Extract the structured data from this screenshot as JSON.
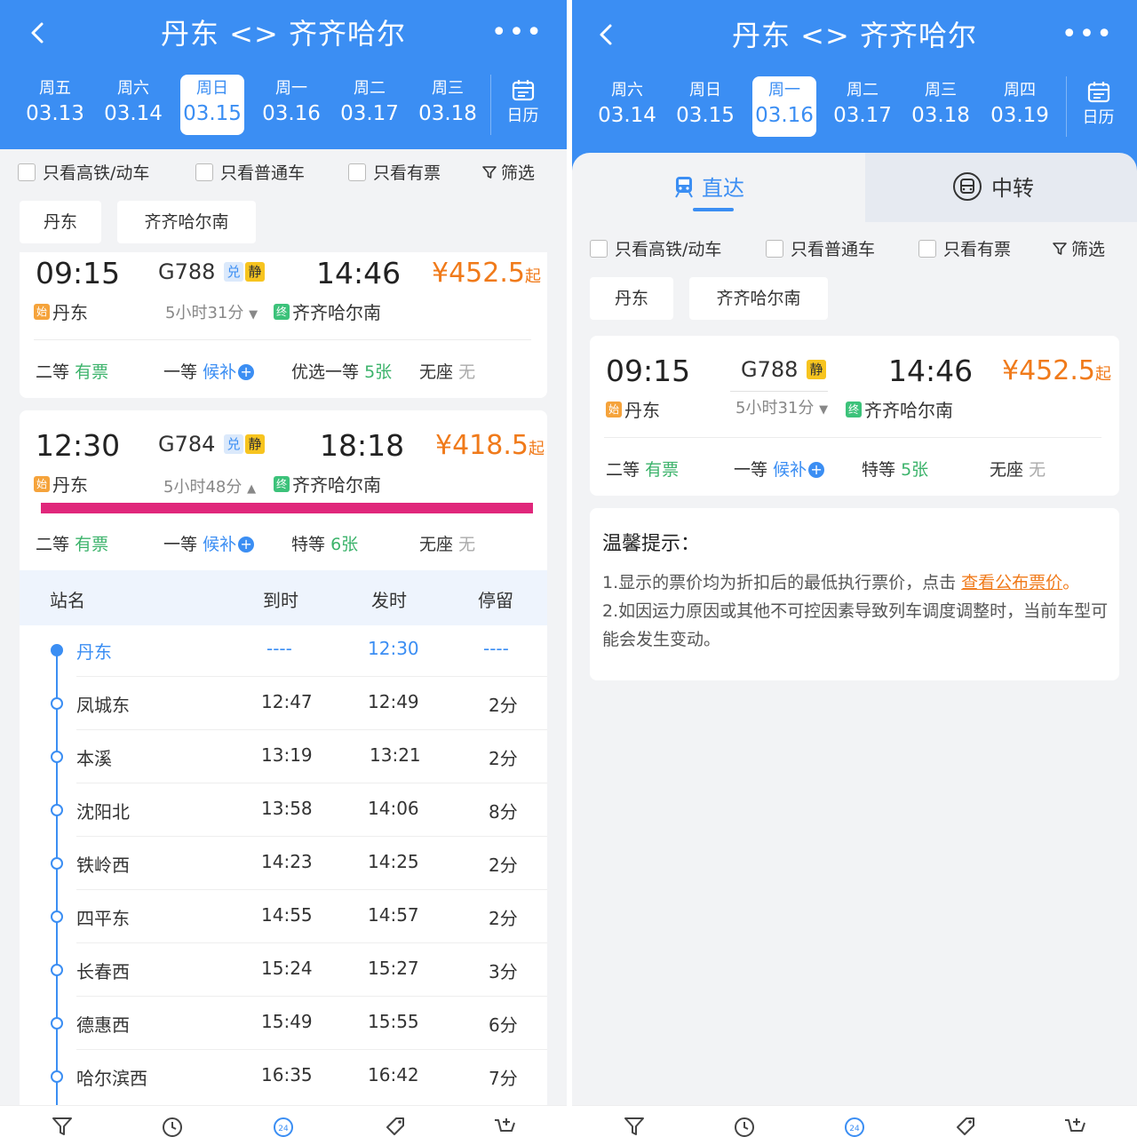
{
  "left": {
    "header": {
      "title": "丹东 <> 齐齐哈尔",
      "more": "•••"
    },
    "dates": [
      {
        "week": "周五",
        "date": "03.13"
      },
      {
        "week": "周六",
        "date": "03.14"
      },
      {
        "week": "周日",
        "date": "03.15",
        "selected": true
      },
      {
        "week": "周一",
        "date": "03.16"
      },
      {
        "week": "周二",
        "date": "03.17"
      },
      {
        "week": "周三",
        "date": "03.18"
      }
    ],
    "calendar_label": "日历",
    "filters": [
      "只看高铁/动车",
      "只看普通车",
      "只看有票"
    ],
    "filter_button": "筛选",
    "stations": [
      "丹东",
      "齐齐哈尔南"
    ],
    "trains": [
      {
        "dep": "09:15",
        "arr": "14:46",
        "no": "G788",
        "tags": [
          "兑",
          "静"
        ],
        "start_badge": "始",
        "from": "丹东",
        "end_badge": "终",
        "to": "齐齐哈尔南",
        "duration": "5小时31分",
        "price": "¥452.5",
        "price_suffix": "起",
        "seats": [
          {
            "name": "二等",
            "status": "有票",
            "color": "green"
          },
          {
            "name": "一等",
            "status": "候补",
            "color": "blue",
            "plus": true
          },
          {
            "name": "优选一等",
            "status": "5张",
            "color": "green"
          },
          {
            "name": "无座",
            "status": "无",
            "color": "gray"
          }
        ]
      },
      {
        "dep": "12:30",
        "arr": "18:18",
        "no": "G784",
        "tags": [
          "兑",
          "静"
        ],
        "start_badge": "始",
        "from": "丹东",
        "end_badge": "终",
        "to": "齐齐哈尔南",
        "duration": "5小时48分",
        "price": "¥418.5",
        "price_suffix": "起",
        "seats": [
          {
            "name": "二等",
            "status": "有票",
            "color": "green"
          },
          {
            "name": "一等",
            "status": "候补",
            "color": "blue",
            "plus": true
          },
          {
            "name": "特等",
            "status": "6张",
            "color": "green"
          },
          {
            "name": "无座",
            "status": "无",
            "color": "gray"
          }
        ]
      }
    ],
    "schedule": {
      "headers": [
        "站名",
        "到时",
        "发时",
        "停留"
      ],
      "rows": [
        {
          "name": "丹东",
          "arr": "----",
          "dep": "12:30",
          "stay": "----"
        },
        {
          "name": "凤城东",
          "arr": "12:47",
          "dep": "12:49",
          "stay": "2分"
        },
        {
          "name": "本溪",
          "arr": "13:19",
          "dep": "13:21",
          "stay": "2分"
        },
        {
          "name": "沈阳北",
          "arr": "13:58",
          "dep": "14:06",
          "stay": "8分"
        },
        {
          "name": "铁岭西",
          "arr": "14:23",
          "dep": "14:25",
          "stay": "2分"
        },
        {
          "name": "四平东",
          "arr": "14:55",
          "dep": "14:57",
          "stay": "2分"
        },
        {
          "name": "长春西",
          "arr": "15:24",
          "dep": "15:27",
          "stay": "3分"
        },
        {
          "name": "德惠西",
          "arr": "15:49",
          "dep": "15:55",
          "stay": "6分"
        },
        {
          "name": "哈尔滨西",
          "arr": "16:35",
          "dep": "16:42",
          "stay": "7分"
        }
      ]
    }
  },
  "right": {
    "header": {
      "title": "丹东 <> 齐齐哈尔",
      "more": "•••"
    },
    "dates": [
      {
        "week": "周六",
        "date": "03.14"
      },
      {
        "week": "周日",
        "date": "03.15"
      },
      {
        "week": "周一",
        "date": "03.16",
        "selected": true
      },
      {
        "week": "周二",
        "date": "03.17"
      },
      {
        "week": "周三",
        "date": "03.18"
      },
      {
        "week": "周四",
        "date": "03.19"
      }
    ],
    "calendar_label": "日历",
    "mode_tabs": {
      "direct": "直达",
      "transfer": "中转"
    },
    "filters": [
      "只看高铁/动车",
      "只看普通车",
      "只看有票"
    ],
    "filter_button": "筛选",
    "stations": [
      "丹东",
      "齐齐哈尔南"
    ],
    "train": {
      "dep": "09:15",
      "arr": "14:46",
      "no": "G788",
      "tags": [
        "静"
      ],
      "start_badge": "始",
      "from": "丹东",
      "end_badge": "终",
      "to": "齐齐哈尔南",
      "duration": "5小时31分",
      "price": "¥452.5",
      "price_suffix": "起",
      "seats": [
        {
          "name": "二等",
          "status": "有票"
        },
        {
          "name": "一等",
          "status": "候补"
        },
        {
          "name": "特等",
          "status": "5张"
        },
        {
          "name": "无座",
          "status": "无"
        }
      ]
    },
    "tips": {
      "heading": "温馨提示：",
      "line1_prefix": "1.显示的票价均为折扣后的最低执行票价，点击 ",
      "line1_link": "查看公布票价",
      "line1_suffix": "。",
      "line2": "2.如因运力原因或其他不可控因素导致列车调度调整时，当前车型可能会发生变动。"
    }
  },
  "colors": {
    "brand": "#3b8ef3",
    "price": "#f07a1a",
    "available": "#3cb36b",
    "highlight": "#e0277b"
  },
  "icons": [
    "back-arrow-icon",
    "more-icon",
    "calendar-icon",
    "filter-icon",
    "train-icon",
    "bus-icon",
    "tab-filter-icon",
    "tab-clock-icon",
    "tab-24h-icon",
    "tab-tag-icon",
    "tab-cart-icon"
  ]
}
